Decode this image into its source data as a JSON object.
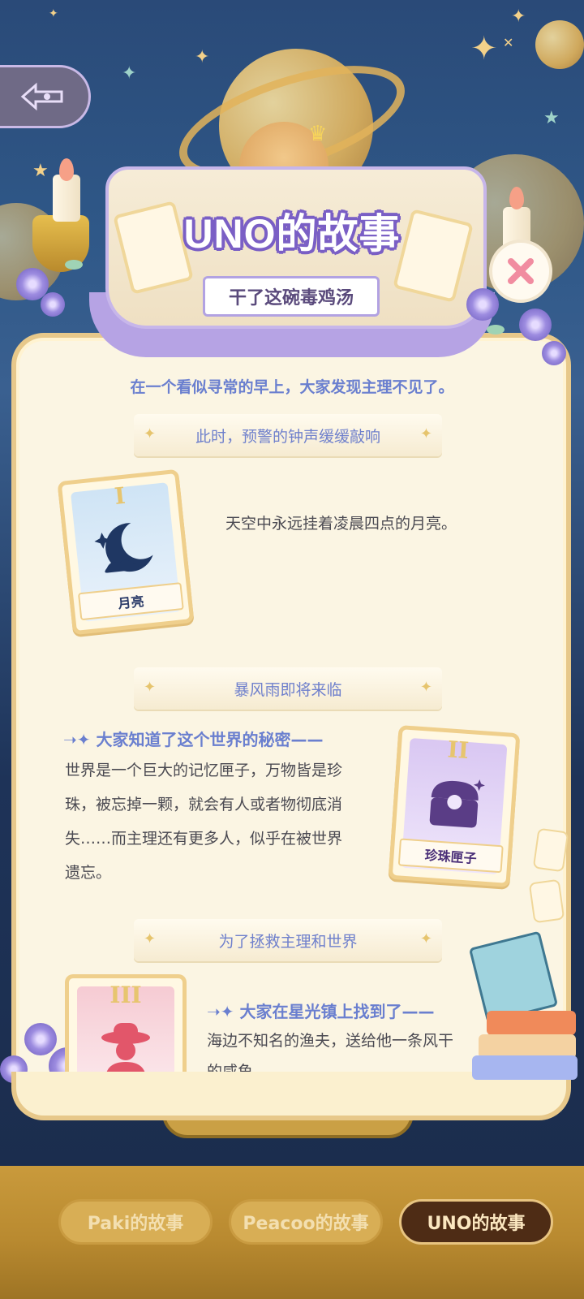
{
  "header": {
    "title": "UNO的故事",
    "subtitle": "干了这碗毒鸡汤"
  },
  "story": {
    "intro": "在一个看似寻常的早上，大家发现主理不见了。",
    "sections": [
      {
        "banner": "此时，预警的钟声缓缓敲响",
        "card_numeral": "I",
        "card_name": "月亮",
        "text": "天空中永远挂着凌晨四点的月亮。"
      },
      {
        "banner": "暴风雨即将来临",
        "heading": "大家知道了这个世界的秘密——",
        "body_lines": [
          "世界是一个巨大的记忆匣子，万物皆是珍",
          "珠，被忘掉一颗，就会有人或者物彻底消",
          "失……而主理还有更多人，似乎在被世界",
          "遗忘。"
        ],
        "card_numeral": "II",
        "card_name": "珍珠匣子"
      },
      {
        "banner": "为了拯救主理和世界",
        "heading": "大家在星光镇上找到了——",
        "body_lines": [
          "海边不知名的渔夫，送给他一条风干",
          "的咸鱼。"
        ],
        "card_numeral": "III"
      }
    ]
  },
  "tabs": [
    {
      "label": "Paki的故事",
      "active": false
    },
    {
      "label": "Peacoo的故事",
      "active": false
    },
    {
      "label": "UNO的故事",
      "active": true
    }
  ],
  "icons": {
    "back": "back-arrow-icon",
    "close": "close-icon"
  },
  "colors": {
    "accent_purple": "#7a5fc5",
    "text_blue": "#6a7fcf",
    "active_tab": "#4e2c15",
    "close_x": "#f18ca0"
  }
}
